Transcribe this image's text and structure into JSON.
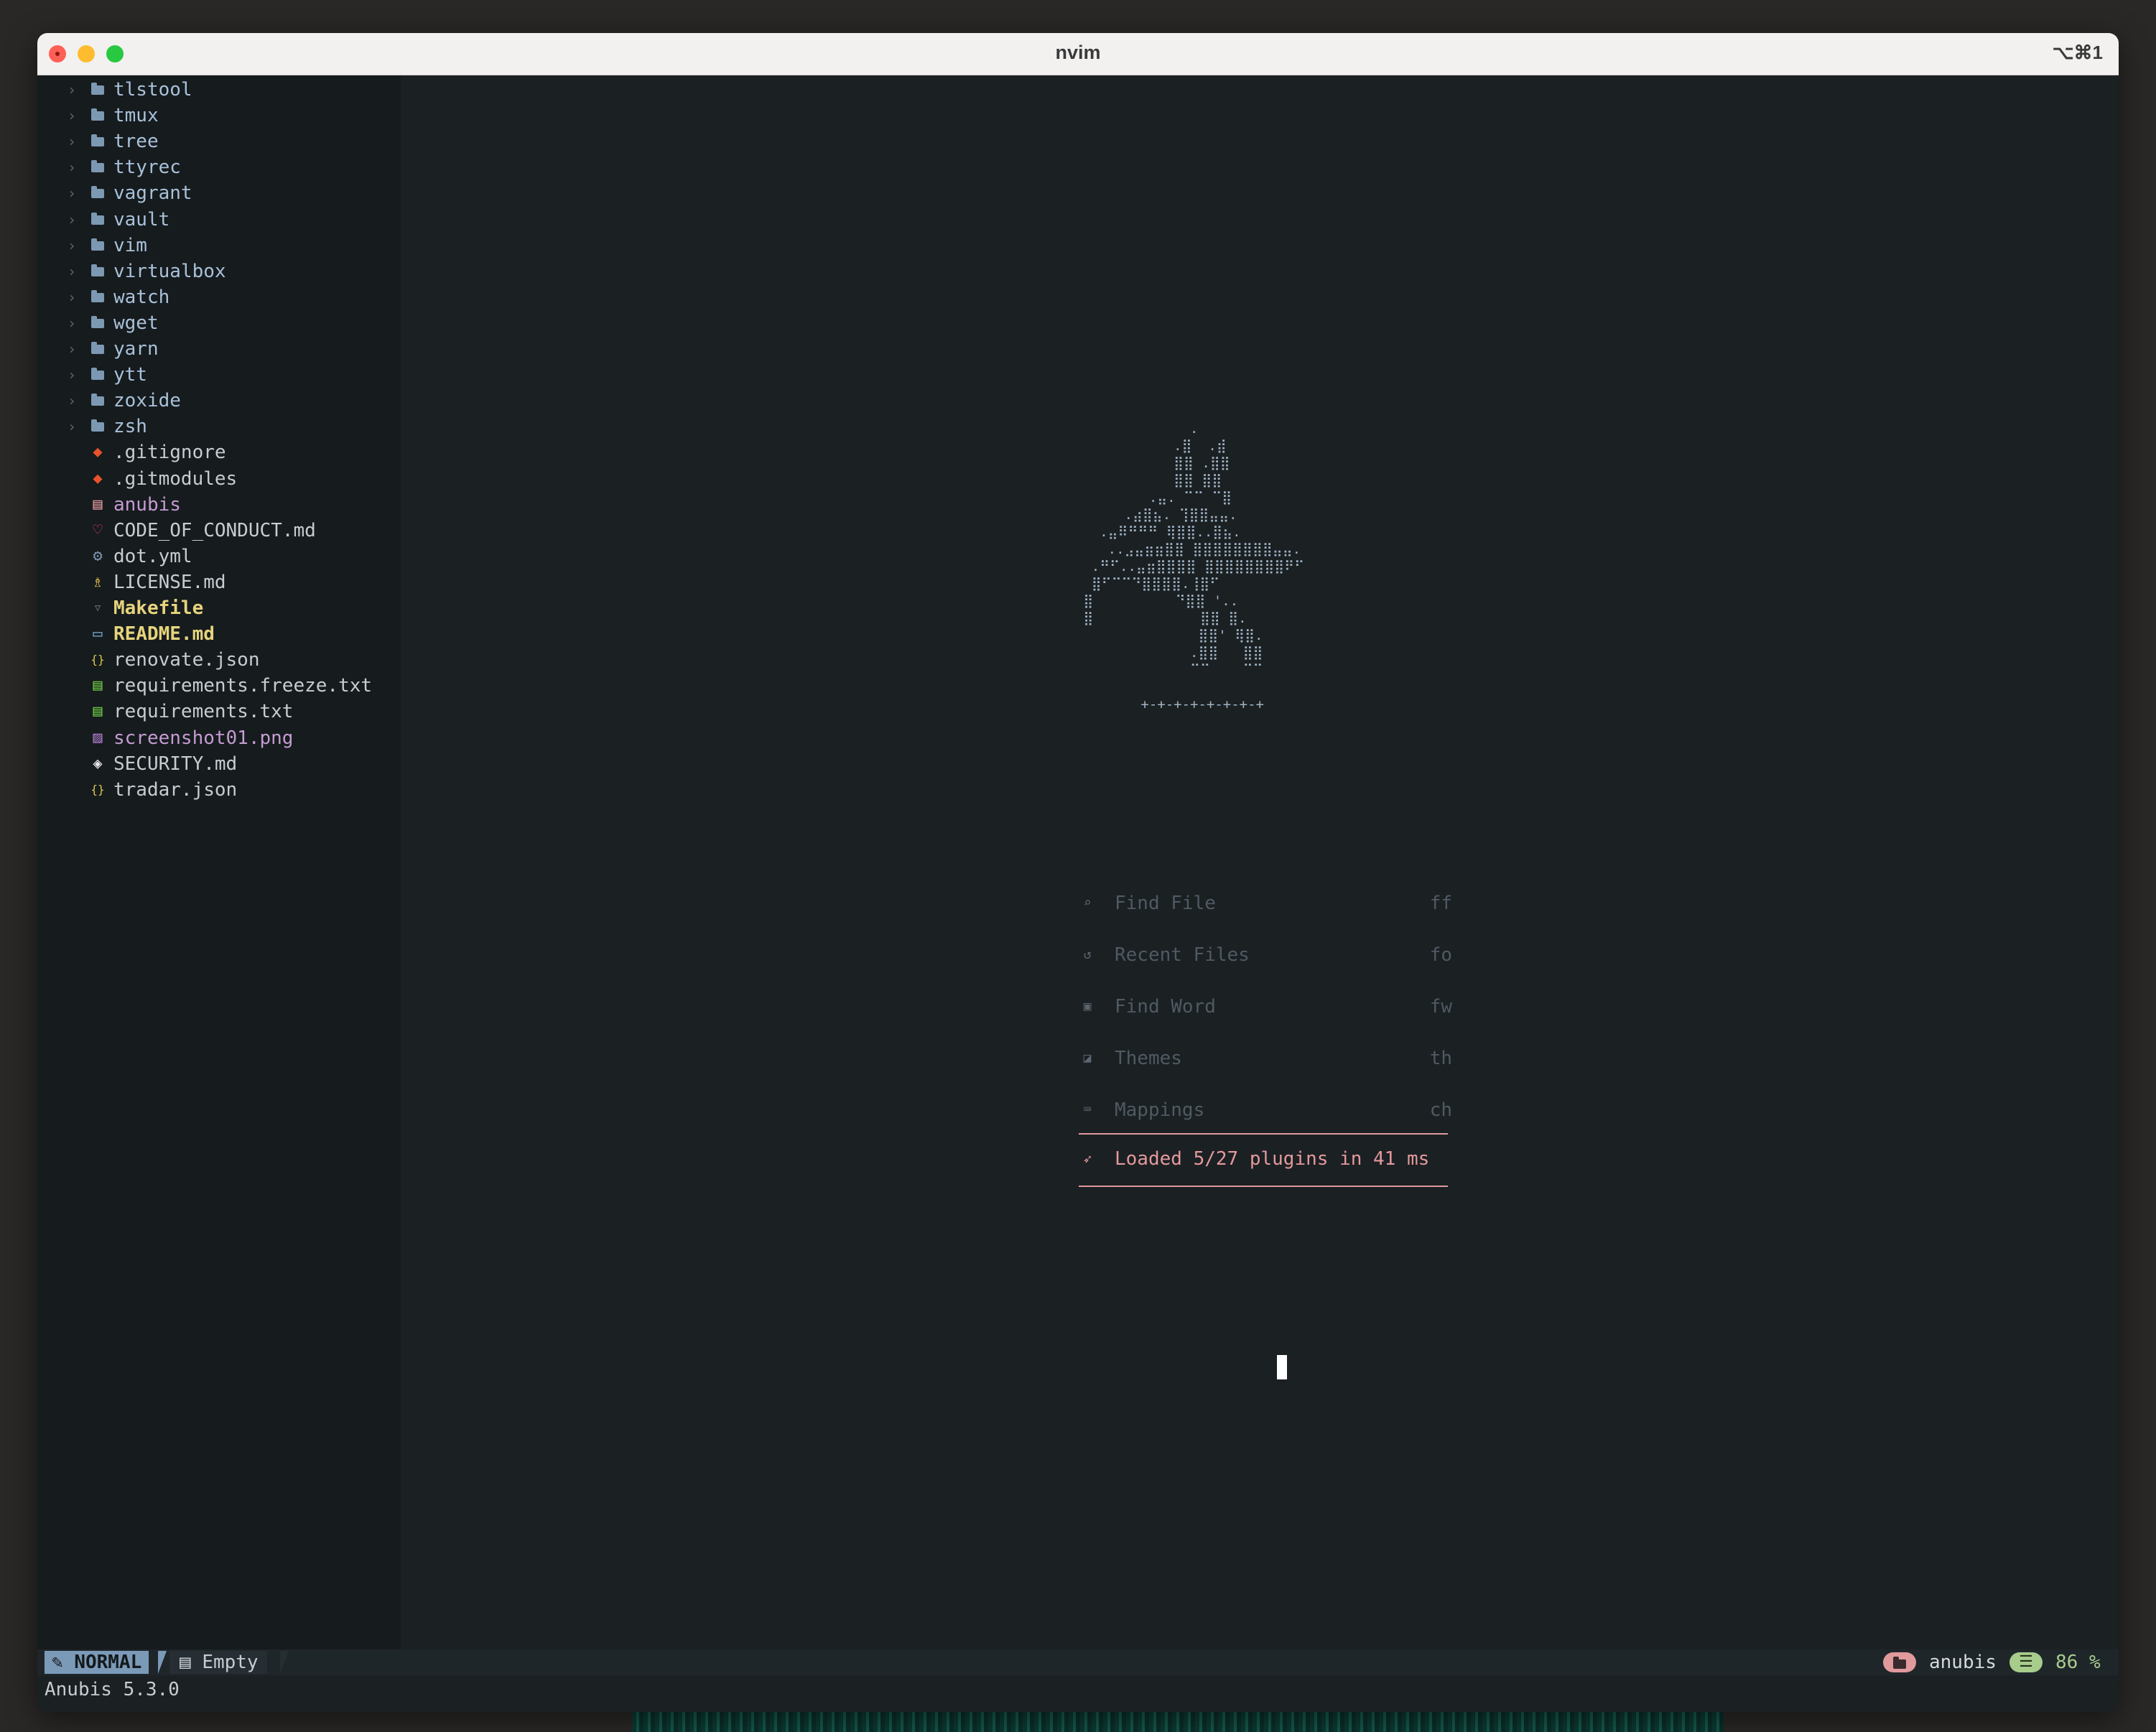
{
  "window": {
    "title": "nvim",
    "shortcut": "⌥⌘1"
  },
  "sidebar": {
    "items": [
      {
        "name": "tlstool",
        "type": "folder",
        "color": "#a9c1d9"
      },
      {
        "name": "tmux",
        "type": "folder",
        "color": "#a9c1d9"
      },
      {
        "name": "tree",
        "type": "folder",
        "color": "#a9c1d9"
      },
      {
        "name": "ttyrec",
        "type": "folder",
        "color": "#a9c1d9"
      },
      {
        "name": "vagrant",
        "type": "folder",
        "color": "#a9c1d9"
      },
      {
        "name": "vault",
        "type": "folder",
        "color": "#a9c1d9"
      },
      {
        "name": "vim",
        "type": "folder",
        "color": "#a9c1d9"
      },
      {
        "name": "virtualbox",
        "type": "folder",
        "color": "#a9c1d9"
      },
      {
        "name": "watch",
        "type": "folder",
        "color": "#a9c1d9"
      },
      {
        "name": "wget",
        "type": "folder",
        "color": "#a9c1d9"
      },
      {
        "name": "yarn",
        "type": "folder",
        "color": "#a9c1d9"
      },
      {
        "name": "ytt",
        "type": "folder",
        "color": "#a9c1d9"
      },
      {
        "name": "zoxide",
        "type": "folder",
        "color": "#a9c1d9"
      },
      {
        "name": "zsh",
        "type": "folder",
        "color": "#a9c1d9"
      },
      {
        "name": ".gitignore",
        "type": "file",
        "icon": "git-icon",
        "glyph": "◆",
        "icon_color": "#e8532b",
        "color": "#c7ccd1"
      },
      {
        "name": ".gitmodules",
        "type": "file",
        "icon": "git-icon",
        "glyph": "◆",
        "icon_color": "#e8532b",
        "color": "#c7ccd1"
      },
      {
        "name": "anubis",
        "type": "file",
        "icon": "binary-icon",
        "glyph": "▤",
        "icon_color": "#e09a9c",
        "color": "#c49bd1"
      },
      {
        "name": "CODE_OF_CONDUCT.md",
        "type": "file",
        "icon": "heart-icon",
        "glyph": "♡",
        "icon_color": "#e0387a",
        "color": "#c7ccd1"
      },
      {
        "name": "dot.yml",
        "type": "file",
        "icon": "gear-icon",
        "glyph": "⚙",
        "icon_color": "#7d98b2",
        "color": "#c7ccd1"
      },
      {
        "name": "LICENSE.md",
        "type": "file",
        "icon": "license-icon",
        "glyph": "♗",
        "icon_color": "#e8c547",
        "color": "#c7ccd1"
      },
      {
        "name": "Makefile",
        "type": "file",
        "icon": "makefile-icon",
        "glyph": "▿",
        "icon_color": "#5b6670",
        "color": "#e6d47c",
        "bold": true
      },
      {
        "name": "README.md",
        "type": "file",
        "icon": "markdown-icon",
        "glyph": "▭",
        "icon_color": "#7ab0d8",
        "color": "#e6d47c",
        "bold": true
      },
      {
        "name": "renovate.json",
        "type": "file",
        "icon": "json-icon",
        "glyph": "{}",
        "icon_color": "#d8c94a",
        "color": "#c7ccd1"
      },
      {
        "name": "requirements.freeze.txt",
        "type": "file",
        "icon": "text-file-icon",
        "glyph": "▤",
        "icon_color": "#6cc644",
        "color": "#c7ccd1"
      },
      {
        "name": "requirements.txt",
        "type": "file",
        "icon": "text-file-icon",
        "glyph": "▤",
        "icon_color": "#6cc644",
        "color": "#c7ccd1"
      },
      {
        "name": "screenshot01.png",
        "type": "file",
        "icon": "image-icon",
        "glyph": "▨",
        "icon_color": "#a678c4",
        "color": "#c49bd1"
      },
      {
        "name": "SECURITY.md",
        "type": "file",
        "icon": "shield-icon",
        "glyph": "◈",
        "icon_color": "#e8e8e8",
        "color": "#c7ccd1"
      },
      {
        "name": "tradar.json",
        "type": "file",
        "icon": "json-icon",
        "glyph": "{}",
        "icon_color": "#d8c94a",
        "color": "#c7ccd1"
      }
    ]
  },
  "dashboard": {
    "ascii_art": "                .\n              .⣿  .⣾\n              ⣿⣿ .⣿⣿\n              ⣿⣿ ⣿⣿\n           .⣤. ⠉⠉ ⠉⣿\n        .⣴⣿⣦. ⢹⣿⣿⣤⣤.\n     .⣤⠿⠛⠛⠛ ⢿⣿⣿..⣿⣦.\n      ..⣠⣤⣶⣶⣿⣿ ⣿⣿⣿⣿⣿⣿⣿⣿⣤⣤.\n    .⠛⠋..⣤⣶⣿⣿⣿⣿ ⣿⣿⣿⣿⣿⣿⣿⣿⠟⠋\n    ⣿⠋⠉⠉⠙⣿⣿⣿⣿.⢸⣿⠋\n   ⣿          ⠙⣿⣿ '..\n   ⣿             ⣿⣿ ⣿.\n                 ⣿⣿' ⢿⣿.\n                .⣿⣿   ⣿⣿\n                ⠉⠉    ⠉⠉\n\n          +-+-+-+-+-+-+-+",
    "menu": [
      {
        "icon": "search-icon",
        "glyph": "⌕",
        "label": "Find File",
        "key": "ff"
      },
      {
        "icon": "history-icon",
        "glyph": "↺",
        "label": "Recent Files",
        "key": "fo"
      },
      {
        "icon": "word-icon",
        "glyph": "▣",
        "label": "Find Word",
        "key": "fw"
      },
      {
        "icon": "palette-icon",
        "glyph": "◪",
        "label": "Themes",
        "key": "th"
      },
      {
        "icon": "keyboard-icon",
        "glyph": "⌨",
        "label": "Mappings",
        "key": "ch"
      }
    ],
    "footer": {
      "icon": "rocket-icon",
      "glyph": "➶",
      "text": "Loaded 5/27 plugins in 41 ms"
    }
  },
  "statusline": {
    "mode_icon": "vim-icon",
    "mode_glyph": "✎",
    "mode": "NORMAL",
    "buffer_icon": "file-icon",
    "buffer_glyph": "▤",
    "buffer": "Empty",
    "dir_icon": "folder-icon",
    "directory": "anubis",
    "progress_icon": "lines-icon",
    "progress_glyph": "☰",
    "progress": "86 %"
  },
  "cmdline": {
    "text": "Anubis 5.3.0"
  },
  "colors": {
    "accent_folder": "#7d98b2",
    "mode_bg": "#7b9ab8",
    "loaded_color": "#e4999c",
    "progress_color": "#a8cc8c"
  }
}
